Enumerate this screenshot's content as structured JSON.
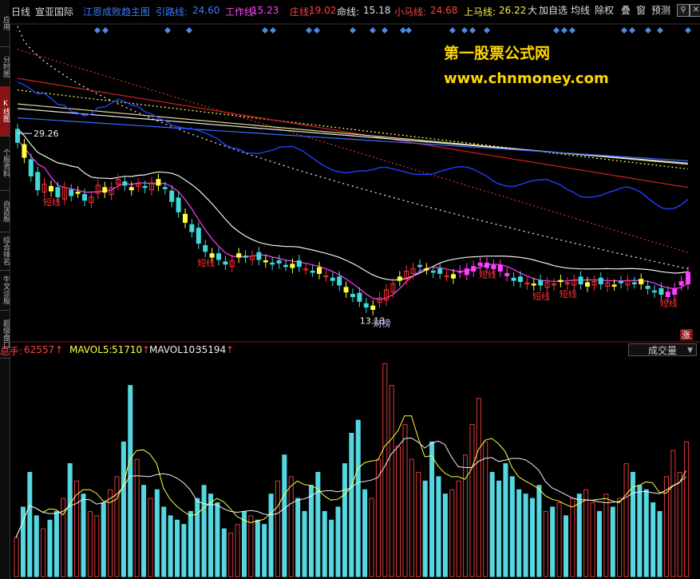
{
  "sidebar": {
    "tabs": [
      {
        "label": "应用",
        "active": false
      },
      {
        "label": "分时图",
        "active": false
      },
      {
        "label": "K线图",
        "active": true
      },
      {
        "label": "个股资料",
        "active": false
      },
      {
        "label": "自选股",
        "active": false
      },
      {
        "label": "综合排名",
        "active": false
      },
      {
        "label": "牛叉诊股",
        "active": false
      },
      {
        "label": "超级盘口",
        "active": false
      }
    ]
  },
  "header": {
    "period": "日线",
    "stock_name": "宣亚国际",
    "indicator_name": "江恩成败趋主图",
    "lines": [
      {
        "label": "引路线:",
        "value": "24.60",
        "color": "#3b7bff"
      },
      {
        "label": "工作线:",
        "value": "15.23",
        "color": "#ff44ff"
      },
      {
        "label": "庄线:",
        "value": "19.02",
        "color": "#ff4040"
      },
      {
        "label": "命线:",
        "value": "15.18",
        "color": "#e0e0e0"
      },
      {
        "label": "小马线:",
        "value": "24.68",
        "color": "#ff4040"
      },
      {
        "label": "上马线:",
        "value": "26.22",
        "color": "#ffee44"
      }
    ],
    "buttons": [
      "大",
      "加自选",
      "均线",
      "除权",
      "叠",
      "窗",
      "预测"
    ],
    "search_icon": "search-icon",
    "close_icon": "close-icon"
  },
  "watermark": {
    "line1": "第一股票公式网",
    "line2": "www.chnmoney.com"
  },
  "annotations": {
    "high_price": "29.26",
    "low_price": "13.13",
    "short_label": "短线",
    "rank_label": "财榜",
    "rise_badge": "涨"
  },
  "volume": {
    "total_label": "总手:",
    "total_value": "62557",
    "mavol5_label": "MAVOL5:",
    "mavol5_value": "51710",
    "mavol10_label": "MAVOL10:",
    "mavol10_value": "35194",
    "selector": "成交量",
    "arrow_up": "↑"
  },
  "colors": {
    "up": "#ff3030",
    "down": "#40d8d8",
    "yellow": "#ffff40",
    "magenta": "#ff40ff",
    "white_line": "#f0f0f0",
    "blue_line": "#3050ff",
    "red_line": "#e03030",
    "gold_text": "#ffd700"
  },
  "chart_data": {
    "type": "candlestick",
    "price_axis_estimate": [
      12,
      38
    ],
    "candles_close": [
      28.5,
      27.2,
      25.6,
      24.4,
      24.9,
      24.3,
      23.8,
      24.6,
      23.9,
      24.2,
      23.5,
      23.8,
      24.8,
      24.2,
      24.6,
      25.3,
      24.8,
      24.4,
      24.9,
      24.6,
      25.0,
      24.8,
      24.5,
      23.4,
      22.5,
      21.6,
      20.8,
      19.8,
      19.1,
      18.6,
      18.4,
      18.0,
      18.3,
      18.9,
      18.6,
      18.7,
      18.4,
      18.3,
      18.0,
      18.1,
      17.9,
      18.0,
      17.8,
      17.6,
      17.4,
      17.2,
      17.0,
      16.6,
      16.2,
      15.6,
      15.2,
      14.8,
      14.3,
      14.4,
      15.1,
      15.8,
      16.3,
      16.9,
      17.4,
      17.6,
      17.8,
      17.6,
      17.3,
      17.2,
      17.0,
      17.1,
      17.3,
      17.6,
      17.8,
      17.9,
      18.1,
      17.6,
      17.4,
      17.0,
      16.6,
      16.5,
      16.4,
      16.3,
      16.2,
      16.4,
      16.3,
      16.5,
      16.4,
      16.6,
      16.3,
      16.4,
      16.5,
      16.3,
      16.4,
      16.2,
      16.4,
      16.6,
      16.4,
      16.3,
      15.9,
      15.6,
      15.4,
      15.6,
      15.9,
      16.5,
      17.3
    ],
    "volume_bars": [
      18,
      32,
      48,
      28,
      22,
      26,
      30,
      36,
      52,
      44,
      38,
      30,
      28,
      34,
      40,
      46,
      62,
      88,
      54,
      42,
      36,
      40,
      32,
      28,
      26,
      24,
      30,
      36,
      42,
      38,
      34,
      22,
      20,
      24,
      30,
      28,
      26,
      24,
      38,
      44,
      56,
      46,
      36,
      30,
      42,
      48,
      30,
      26,
      32,
      52,
      66,
      72,
      40,
      36,
      54,
      98,
      88,
      60,
      70,
      54,
      48,
      44,
      62,
      46,
      38,
      40,
      44,
      56,
      70,
      82,
      62,
      48,
      44,
      52,
      46,
      40,
      38,
      36,
      42,
      30,
      32,
      34,
      28,
      36,
      38,
      40,
      34,
      30,
      38,
      32,
      36,
      52,
      48,
      42,
      40,
      34,
      30,
      46,
      58,
      48,
      62
    ],
    "volume_unit": "手"
  }
}
